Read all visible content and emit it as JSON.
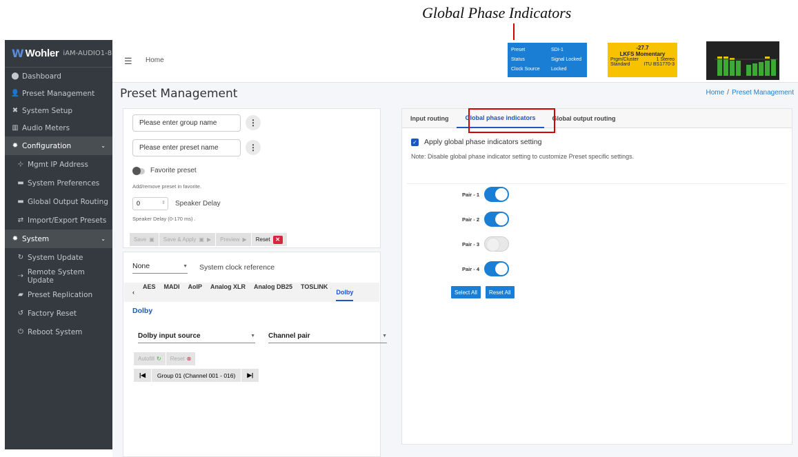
{
  "annotation": {
    "title": "Global Phase Indicators"
  },
  "sidebar": {
    "brand_logo": "Wohler",
    "brand_model": "iAM-AUDIO1-8",
    "items": [
      {
        "label": "Dashboard",
        "icon": "dashboard-icon",
        "glyph": "⬤"
      },
      {
        "label": "Preset Management",
        "icon": "users-icon",
        "glyph": "👤"
      },
      {
        "label": "System Setup",
        "icon": "tools-icon",
        "glyph": "✖"
      },
      {
        "label": "Audio Meters",
        "icon": "meter-icon",
        "glyph": "▥"
      }
    ],
    "config_group": {
      "label": "Configuration",
      "icon": "gear-icon"
    },
    "config_items": [
      {
        "label": "Mgmt IP Address",
        "icon": "network-icon",
        "glyph": "⊹"
      },
      {
        "label": "System Preferences",
        "icon": "preferences-icon",
        "glyph": "▬"
      },
      {
        "label": "Global Output Routing",
        "icon": "routing-icon",
        "glyph": "▬"
      },
      {
        "label": "Import/Export Presets",
        "icon": "exchange-icon",
        "glyph": "⇄"
      }
    ],
    "system_group": {
      "label": "System",
      "icon": "cogs-icon"
    },
    "system_items": [
      {
        "label": "System Update",
        "icon": "sync-icon",
        "glyph": "↻"
      },
      {
        "label": "Remote System Update",
        "icon": "remote-icon",
        "glyph": "⇢"
      },
      {
        "label": "Preset Replication",
        "icon": "copy-icon",
        "glyph": "▰"
      },
      {
        "label": "Factory Reset",
        "icon": "undo-icon",
        "glyph": "↺"
      },
      {
        "label": "Reboot System",
        "icon": "power-icon",
        "glyph": "⏻"
      }
    ]
  },
  "header": {
    "home": "Home",
    "status": {
      "preset_k": "Preset",
      "preset_v": "SDI-1",
      "status_k": "Status",
      "status_v": "Signal Locked",
      "clock_k": "Clock Source",
      "clock_v": "Locked"
    },
    "loudness": {
      "value": "-27.7",
      "mode": "LKFS  Momentary",
      "cluster_k": "Prgm/Cluster",
      "cluster_v": "1  Stereo",
      "standard_k": "Standard",
      "standard_v": "ITU BS1770-3"
    }
  },
  "page": {
    "title": "Preset Management",
    "breadcrumb_home": "Home",
    "breadcrumb_sep": "/",
    "breadcrumb_current": "Preset Management"
  },
  "left_panel": {
    "group_placeholder": "Please enter group name",
    "preset_placeholder": "Please enter preset name",
    "favorite_label": "Favorite preset",
    "favorite_help": "Add/remove preset in favorite.",
    "delay_value": "0",
    "delay_label": "Speaker Delay",
    "delay_help": "Speaker Delay (0-170 ms) .",
    "btn_save": "Save",
    "btn_save_apply": "Save & Apply",
    "btn_preview": "Preview",
    "btn_reset": "Reset"
  },
  "source_panel": {
    "clock_value": "None",
    "clock_label": "System clock reference",
    "tabs": [
      "AES",
      "MADI",
      "AoIP",
      "Analog XLR",
      "Analog DB25",
      "TOSLINK",
      "Dolby"
    ],
    "active_tab": "Dolby",
    "section_title": "Dolby",
    "input_source": "Dolby input source",
    "channel_pair": "Channel pair",
    "btn_autofill": "Autofill",
    "btn_reset": "Reset",
    "group_label": "Group 01 (Channel 001 - 016)"
  },
  "right_panel": {
    "tabs": [
      "Input routing",
      "Global phase indicators",
      "Global output routing"
    ],
    "active_tab": "Global phase indicators",
    "apply_label": "Apply global phase indicators setting",
    "note": "Note: Disable global phase indicator setting to customize Preset specific settings.",
    "pairs": [
      {
        "label": "Pair - 1",
        "on": true
      },
      {
        "label": "Pair - 2",
        "on": true
      },
      {
        "label": "Pair - 3",
        "on": false
      },
      {
        "label": "Pair - 4",
        "on": true
      }
    ],
    "btn_select_all": "Select All",
    "btn_reset_all": "Reset All"
  }
}
